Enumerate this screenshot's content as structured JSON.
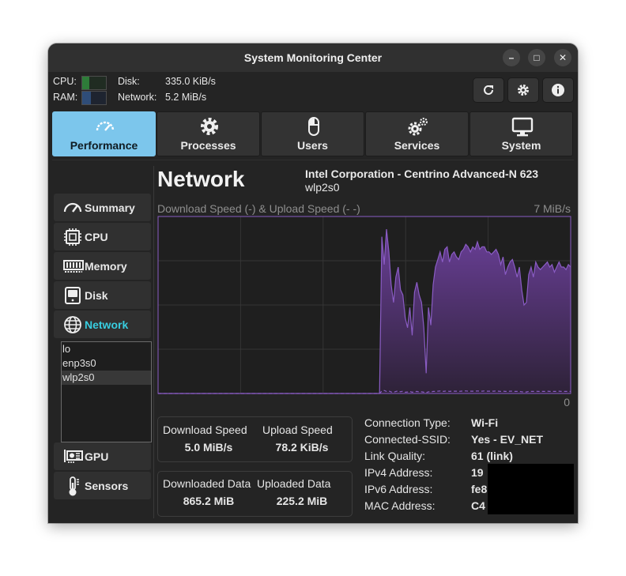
{
  "window": {
    "title": "System Monitoring Center",
    "controls": [
      "–",
      "□",
      "✕"
    ]
  },
  "header": {
    "cpu_label": "CPU:",
    "ram_label": "RAM:",
    "cpu_usage": 0.3,
    "ram_usage": 0.35,
    "disk_label": "Disk:",
    "disk_value": "335.0 KiB/s",
    "network_label": "Network:",
    "network_value": "5.2 MiB/s",
    "toolbar": [
      "refresh-icon",
      "gear-icon",
      "info-icon"
    ]
  },
  "tabs": [
    {
      "label": "Performance",
      "icon": "speedometer-icon",
      "active": true
    },
    {
      "label": "Processes",
      "icon": "gear-icon",
      "active": false
    },
    {
      "label": "Users",
      "icon": "mouse-icon",
      "active": false
    },
    {
      "label": "Services",
      "icon": "gears-icon",
      "active": false
    },
    {
      "label": "System",
      "icon": "monitor-icon",
      "active": false
    }
  ],
  "sidebar": {
    "items": [
      {
        "label": "Summary",
        "icon": "speedometer-icon"
      },
      {
        "label": "CPU",
        "icon": "cpu-chip-icon"
      },
      {
        "label": "Memory",
        "icon": "memory-module-icon"
      },
      {
        "label": "Disk",
        "icon": "disk-icon"
      },
      {
        "label": "Network",
        "icon": "globe-icon",
        "active": true
      },
      {
        "label": "GPU",
        "icon": "gpu-card-icon"
      },
      {
        "label": "Sensors",
        "icon": "thermometer-icon"
      }
    ],
    "network_devices": [
      {
        "name": "lo",
        "selected": false
      },
      {
        "name": "enp3s0",
        "selected": false
      },
      {
        "name": "wlp2s0",
        "selected": true
      }
    ]
  },
  "main": {
    "heading": "Network",
    "device_name": "Intel Corporation - Centrino Advanced-N 623",
    "interface": "wlp2s0",
    "chart_title": "Download Speed (-) & Upload Speed (-  -)",
    "chart_max": "7 MiB/s",
    "chart_min": "0",
    "download_speed_label": "Download Speed",
    "download_speed_value": "5.0 MiB/s",
    "upload_speed_label": "Upload Speed",
    "upload_speed_value": "78.2 KiB/s",
    "downloaded_label": "Downloaded Data",
    "downloaded_value": "865.2 MiB",
    "uploaded_label": "Uploaded Data",
    "uploaded_value": "225.2 MiB",
    "info": [
      {
        "label": "Connection Type:",
        "value": "Wi-Fi"
      },
      {
        "label": "Connected-SSID:",
        "value": "Yes - EV_NET"
      },
      {
        "label": "Link Quality:",
        "value": "61 (link)"
      },
      {
        "label": "IPv4 Address:",
        "value": "19"
      },
      {
        "label": "IPv6 Address:",
        "value": "fe8"
      },
      {
        "label": "MAC Address:",
        "value": "C4"
      }
    ]
  },
  "colors": {
    "accent_tab": "#7cc6ec",
    "active_sidebar_text": "#38cde0",
    "chart_line": "#8a5cc4",
    "chart_fill_top": "#6a3f98",
    "chart_fill_bottom": "#2e2238",
    "ram_bar": "#2f4d78",
    "cpu_bar": "#2e7c39"
  },
  "chart_data": {
    "type": "area",
    "title": "Download Speed (-) & Upload Speed (-  -)",
    "ylim": [
      0,
      7
    ],
    "yunit": "MiB/s",
    "grid": true,
    "series": [
      {
        "name": "Download Speed",
        "values": [
          0,
          0,
          0,
          0,
          0,
          0,
          0,
          0,
          0,
          0,
          0,
          0,
          0,
          0,
          0,
          0,
          0,
          0,
          0,
          0,
          0,
          0,
          0,
          0,
          0,
          0,
          0,
          0,
          0,
          0,
          0,
          0,
          0,
          0,
          0,
          0,
          0,
          0,
          0,
          0,
          0,
          0,
          0,
          0,
          0,
          0,
          0,
          0,
          0,
          0,
          0,
          0,
          0,
          0,
          0,
          0,
          0,
          0,
          0,
          0,
          0,
          0,
          0,
          0,
          0,
          0,
          0,
          0,
          0,
          0,
          0,
          0,
          0,
          0,
          0,
          0,
          0,
          0,
          0,
          0,
          0,
          0,
          0,
          0,
          0,
          0,
          0,
          0,
          0,
          0,
          0,
          0,
          0,
          0,
          0,
          0,
          6.2,
          5.1,
          6.5,
          5.6,
          4.3,
          3.6,
          4.6,
          5.0,
          4.1,
          3.9,
          3.0,
          2.6,
          3.4,
          2.3,
          4.0,
          4.4,
          3.9,
          3.6,
          2.6,
          0.8,
          3.4,
          2.7,
          4.3,
          5.0,
          5.3,
          5.6,
          5.2,
          5.7,
          5.8,
          5.2,
          5.5,
          5.6,
          5.4,
          5.3,
          5.6,
          5.7,
          5.9,
          5.8,
          5.6,
          5.8,
          5.7,
          6.0,
          5.7,
          5.8,
          5.8,
          5.6,
          5.6,
          5.5,
          5.6,
          5.7,
          5.5,
          5.1,
          5.4,
          4.7,
          5.0,
          5.2,
          5.3,
          5.0,
          4.6,
          5.0,
          4.1,
          3.5,
          3.6,
          4.7,
          5.0,
          4.6,
          5.2,
          5.0,
          4.9,
          5.0,
          5.1,
          5.2,
          5.0,
          5.1,
          4.8,
          5.0,
          5.2,
          5.0,
          5.0,
          4.9,
          5.1,
          5.0
        ]
      },
      {
        "name": "Upload Speed",
        "values": [
          0,
          0,
          0,
          0,
          0,
          0,
          0,
          0,
          0,
          0,
          0,
          0,
          0,
          0,
          0,
          0,
          0,
          0,
          0,
          0,
          0,
          0,
          0,
          0,
          0,
          0,
          0,
          0,
          0,
          0,
          0,
          0,
          0,
          0,
          0,
          0,
          0,
          0,
          0,
          0,
          0,
          0,
          0,
          0,
          0,
          0,
          0,
          0,
          0,
          0,
          0,
          0,
          0,
          0,
          0,
          0,
          0,
          0,
          0,
          0,
          0,
          0,
          0,
          0,
          0,
          0,
          0,
          0,
          0,
          0,
          0,
          0,
          0,
          0,
          0,
          0,
          0,
          0,
          0,
          0,
          0,
          0,
          0,
          0,
          0,
          0,
          0,
          0,
          0,
          0,
          0,
          0,
          0,
          0,
          0,
          0,
          0.1,
          0.12,
          0.08,
          0.1,
          0.06,
          0.05,
          0.08,
          0.1,
          0.07,
          0.09,
          0.05,
          0.06,
          0.08,
          0.05,
          0.07,
          0.08,
          0.06,
          0.07,
          0.05,
          0.03,
          0.07,
          0.06,
          0.08,
          0.08,
          0.09,
          0.1,
          0.08,
          0.09,
          0.1,
          0.08,
          0.09,
          0.09,
          0.09,
          0.08,
          0.09,
          0.1,
          0.1,
          0.09,
          0.09,
          0.09,
          0.09,
          0.1,
          0.09,
          0.09,
          0.1,
          0.09,
          0.09,
          0.09,
          0.09,
          0.1,
          0.09,
          0.08,
          0.09,
          0.08,
          0.08,
          0.09,
          0.09,
          0.08,
          0.08,
          0.08,
          0.07,
          0.06,
          0.06,
          0.08,
          0.08,
          0.08,
          0.09,
          0.08,
          0.08,
          0.08,
          0.08,
          0.09,
          0.08,
          0.08,
          0.08,
          0.08,
          0.09,
          0.08,
          0.08,
          0.08,
          0.08,
          0.08
        ]
      }
    ]
  }
}
